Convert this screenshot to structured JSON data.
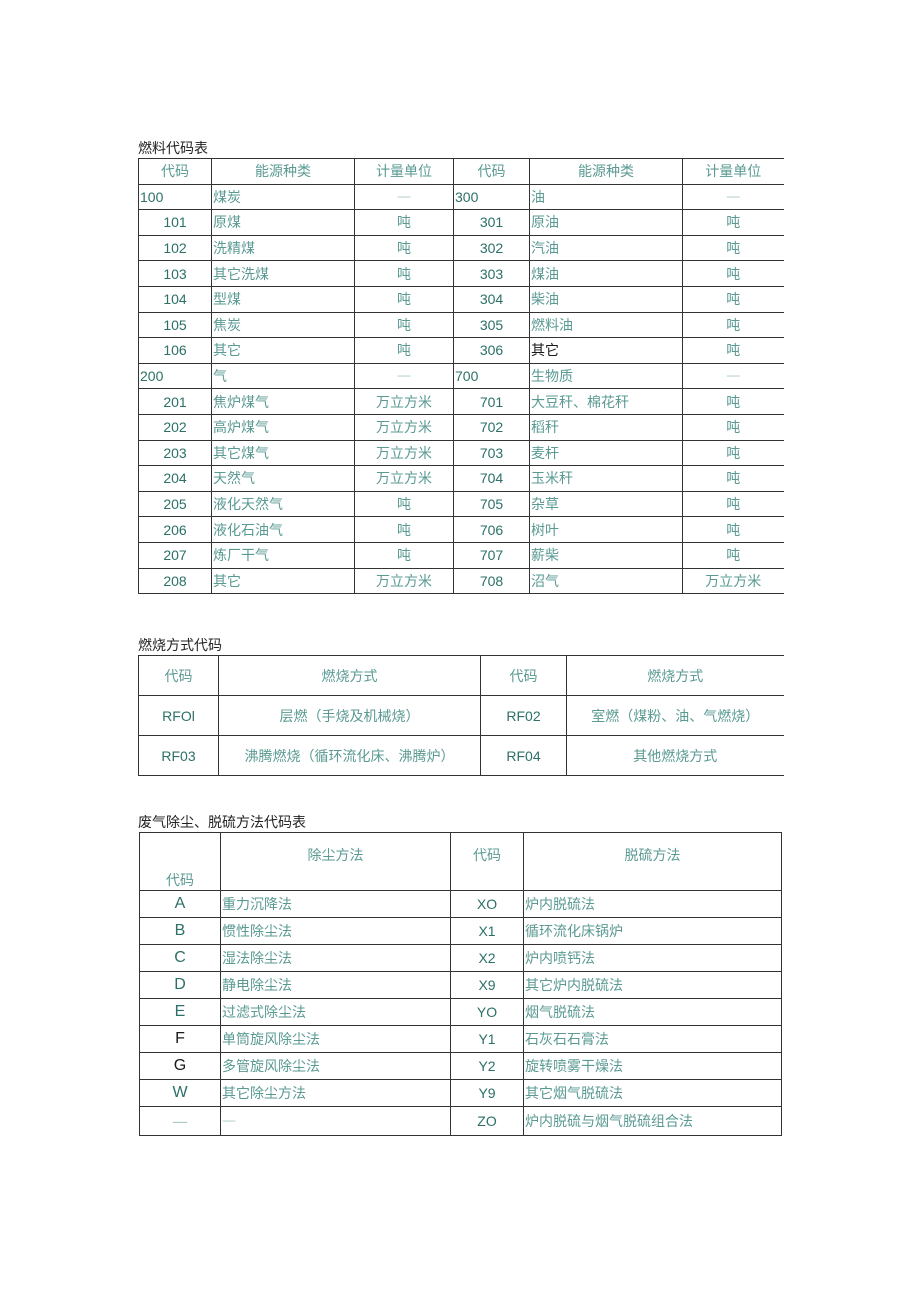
{
  "fuel_table": {
    "title": "燃料代码表",
    "headers": [
      "代码",
      "能源种类",
      "计量单位",
      "代码",
      "能源种类",
      "计量单位"
    ],
    "rows": [
      {
        "code_a": "100",
        "name_a": "煤炭",
        "unit_a": "—",
        "code_b": "300",
        "name_b": "油",
        "unit_b": "—",
        "category": true
      },
      {
        "code_a": "101",
        "name_a": "原煤",
        "unit_a": "吨",
        "code_b": "301",
        "name_b": "原油",
        "unit_b": "吨"
      },
      {
        "code_a": "102",
        "name_a": "洗精煤",
        "unit_a": "吨",
        "code_b": "302",
        "name_b": "汽油",
        "unit_b": "吨"
      },
      {
        "code_a": "103",
        "name_a": "其它洗煤",
        "unit_a": "吨",
        "code_b": "303",
        "name_b": "煤油",
        "unit_b": "吨"
      },
      {
        "code_a": "104",
        "name_a": "型煤",
        "unit_a": "吨",
        "code_b": "304",
        "name_b": "柴油",
        "unit_b": "吨"
      },
      {
        "code_a": "105",
        "name_a": "焦炭",
        "unit_a": "吨",
        "code_b": "305",
        "name_b": "燃料油",
        "unit_b": "吨"
      },
      {
        "code_a": "106",
        "name_a": "其它",
        "unit_a": "吨",
        "code_b": "306",
        "name_b": "其它",
        "unit_b": "吨"
      },
      {
        "code_a": "200",
        "name_a": "气",
        "unit_a": "—",
        "code_b": "700",
        "name_b": "生物质",
        "unit_b": "—",
        "category": true
      },
      {
        "code_a": "201",
        "name_a": "焦炉煤气",
        "unit_a": "万立方米",
        "code_b": "701",
        "name_b": "大豆秆、棉花秆",
        "unit_b": "吨"
      },
      {
        "code_a": "202",
        "name_a": "高炉煤气",
        "unit_a": "万立方米",
        "code_b": "702",
        "name_b": "稻秆",
        "unit_b": "吨"
      },
      {
        "code_a": "203",
        "name_a": "其它煤气",
        "unit_a": "万立方米",
        "code_b": "703",
        "name_b": "麦杆",
        "unit_b": "吨"
      },
      {
        "code_a": "204",
        "name_a": "天然气",
        "unit_a": "万立方米",
        "code_b": "704",
        "name_b": "玉米秆",
        "unit_b": "吨"
      },
      {
        "code_a": "205",
        "name_a": "液化天然气",
        "unit_a": "吨",
        "code_b": "705",
        "name_b": "杂草",
        "unit_b": "吨"
      },
      {
        "code_a": "206",
        "name_a": "液化石油气",
        "unit_a": "吨",
        "code_b": "706",
        "name_b": "树叶",
        "unit_b": "吨"
      },
      {
        "code_a": "207",
        "name_a": "炼厂干气",
        "unit_a": "吨",
        "code_b": "707",
        "name_b": "薪柴",
        "unit_b": "吨"
      },
      {
        "code_a": "208",
        "name_a": "其它",
        "unit_a": "万立方米",
        "code_b": "708",
        "name_b": "沼气",
        "unit_b": "万立方米"
      }
    ]
  },
  "combustion_table": {
    "title": "燃烧方式代码",
    "headers": [
      "代码",
      "燃烧方式",
      "代码",
      "燃烧方式"
    ],
    "rows": [
      {
        "code_a": "RFOl",
        "method_a": "层燃（手烧及机械烧）",
        "code_b": "RF02",
        "method_b": "室燃（煤粉、油、气燃烧）"
      },
      {
        "code_a": "RF03",
        "method_a": "沸腾燃烧（循环流化床、沸腾炉）",
        "code_b": "RF04",
        "method_b": "其他燃烧方式"
      }
    ]
  },
  "waste_gas_table": {
    "title": "废气除尘、脱硫方法代码表",
    "headers": [
      "代码",
      "除尘方法",
      "代码",
      "脱硫方法"
    ],
    "rows": [
      {
        "code_a": "A",
        "method_a": "重力沉降法",
        "code_b": "XO",
        "method_b": "炉内脱硫法"
      },
      {
        "code_a": "B",
        "method_a": "惯性除尘法",
        "code_b": "X1",
        "method_b": "循环流化床锅炉"
      },
      {
        "code_a": "C",
        "method_a": "湿法除尘法",
        "code_b": "X2",
        "method_b": "炉内喷钙法"
      },
      {
        "code_a": "D",
        "method_a": "静电除尘法",
        "code_b": "X9",
        "method_b": "其它炉内脱硫法"
      },
      {
        "code_a": "E",
        "method_a": "过滤式除尘法",
        "code_b": "YO",
        "method_b": "烟气脱硫法"
      },
      {
        "code_a": "F",
        "method_a": "单筒旋风除尘法",
        "code_b": "Y1",
        "method_b": "石灰石石膏法"
      },
      {
        "code_a": "G",
        "method_a": "多管旋风除尘法",
        "code_b": "Y2",
        "method_b": "旋转喷雾干燥法"
      },
      {
        "code_a": "W",
        "method_a": "其它除尘方法",
        "code_b": "Y9",
        "method_b": "其它烟气脱硫法"
      },
      {
        "code_a": "—",
        "method_a": "—",
        "code_b": "ZO",
        "method_b": "炉内脱硫与烟气脱硫组合法"
      }
    ]
  },
  "colors": {
    "code_text": "#2c7068",
    "chinese_text": "#5a9a93",
    "dash": "#a8c9c5",
    "border": "#333333"
  }
}
